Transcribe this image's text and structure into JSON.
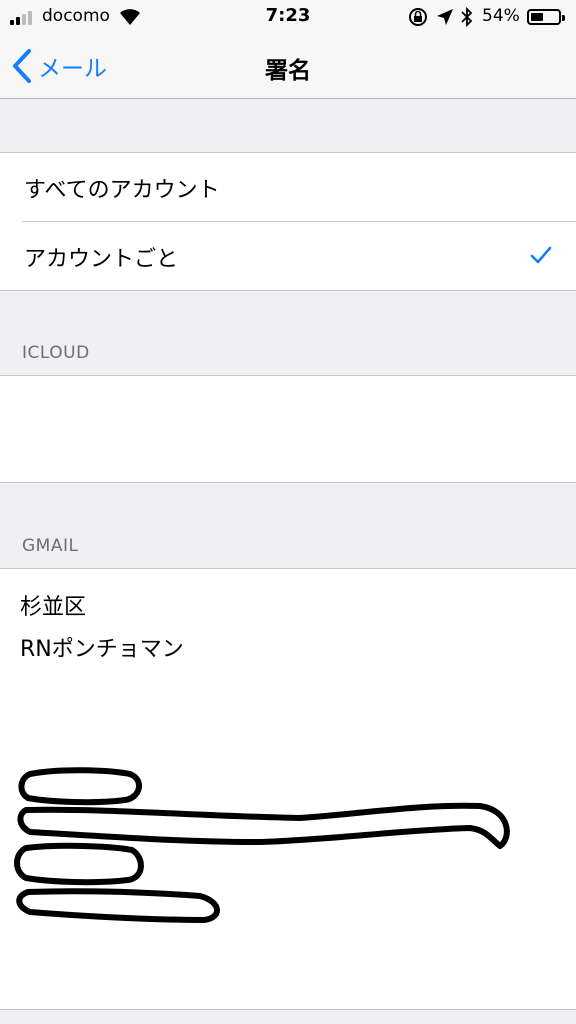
{
  "status": {
    "carrier": "docomo",
    "time": "7:23",
    "battery_percent": "54%",
    "battery_level": 0.54
  },
  "nav": {
    "back_label": "メール",
    "title": "署名"
  },
  "options": [
    {
      "label": "すべてのアカウント",
      "selected": false
    },
    {
      "label": "アカウントごと",
      "selected": true
    }
  ],
  "sections": {
    "icloud": {
      "header": "ICLOUD",
      "signature": ""
    },
    "gmail": {
      "header": "GMAIL",
      "signature_lines": [
        "杉並区",
        "RNポンチョマン"
      ]
    }
  },
  "colors": {
    "accent": "#157efb",
    "background": "#efeff4",
    "header_text": "#6d6d72"
  }
}
